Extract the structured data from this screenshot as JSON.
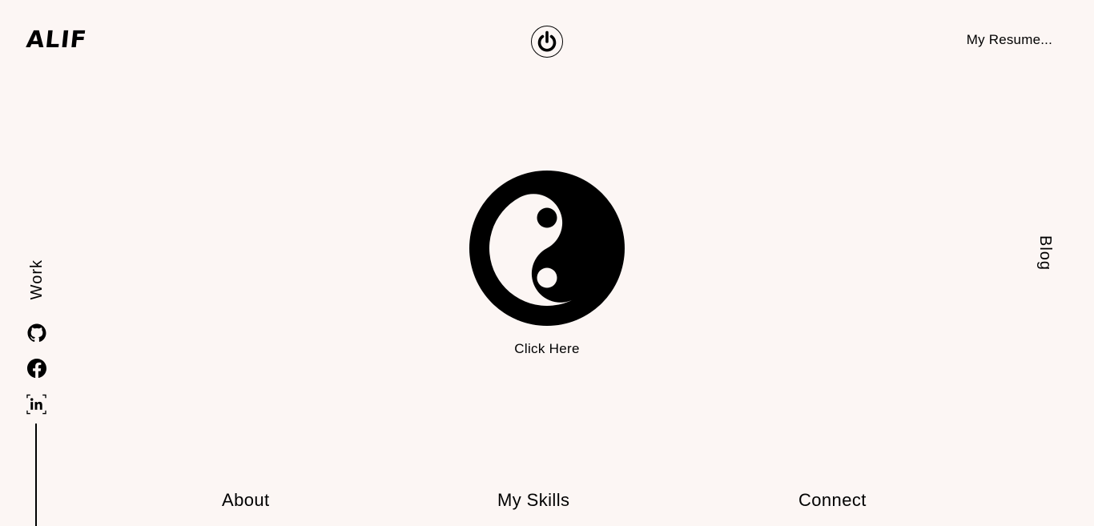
{
  "header": {
    "logo": "ALIF",
    "power_icon": "power-icon",
    "resume_label": "My Resume..."
  },
  "side": {
    "blog_label": "Blog",
    "work_label": "Work",
    "socials": [
      {
        "name": "github",
        "icon": "github-icon"
      },
      {
        "name": "facebook",
        "icon": "facebook-icon"
      },
      {
        "name": "linkedin",
        "icon": "linkedin-icon"
      }
    ]
  },
  "center": {
    "icon": "yin-yang-icon",
    "label": "Click Here"
  },
  "bottom_nav": {
    "about": "About",
    "skills": "My Skills",
    "connect": "Connect"
  },
  "colors": {
    "background": "#FCF6F4",
    "foreground": "#000000"
  }
}
